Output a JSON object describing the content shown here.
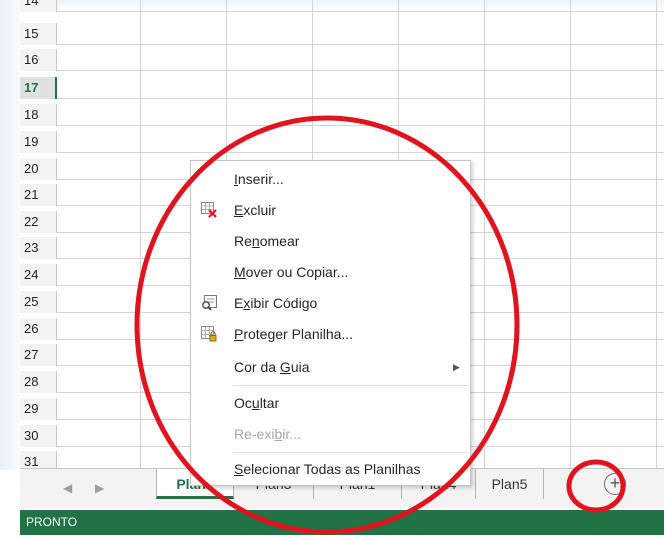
{
  "grid": {
    "partial_row_label": "14",
    "row_numbers": [
      "15",
      "16",
      "17",
      "18",
      "19",
      "20",
      "21",
      "22",
      "23",
      "24",
      "25",
      "26",
      "27",
      "28",
      "29",
      "30",
      "31"
    ],
    "active_row": "17"
  },
  "context_menu": {
    "items": [
      {
        "label": "Inserir...",
        "accel": "I",
        "icon": "",
        "enabled": true
      },
      {
        "label": "Excluir",
        "accel": "E",
        "icon": "delete-sheet-icon",
        "enabled": true
      },
      {
        "label": "Renomear",
        "accel": "n",
        "icon": "",
        "enabled": true
      },
      {
        "label": "Mover ou Copiar...",
        "accel": "M",
        "icon": "",
        "enabled": true
      },
      {
        "label": "Exibir Código",
        "accel": "x",
        "icon": "view-code-icon",
        "enabled": true
      },
      {
        "label": "Proteger Planilha...",
        "accel": "P",
        "icon": "protect-sheet-icon",
        "enabled": true
      },
      {
        "label": "Cor da Guia",
        "accel": "G",
        "icon": "",
        "enabled": true,
        "submenu": true
      },
      {
        "label": "Ocultar",
        "accel": "u",
        "icon": "",
        "enabled": true
      },
      {
        "label": "Re-exibir...",
        "accel": "b",
        "icon": "",
        "enabled": false
      },
      {
        "label": "Selecionar Todas as Planilhas",
        "accel": "S",
        "icon": "",
        "enabled": true
      }
    ]
  },
  "sheet_tabs": {
    "nav_prev": "◀",
    "nav_next": "▶",
    "tabs": [
      "Plan2",
      "Plan3",
      "Plan1",
      "Plan4",
      "Plan5"
    ],
    "active": "Plan2",
    "add_sheet": "+"
  },
  "status_bar": {
    "text": "PRONTO"
  },
  "colors": {
    "accent": "#217346",
    "annotation": "#e0141e"
  }
}
